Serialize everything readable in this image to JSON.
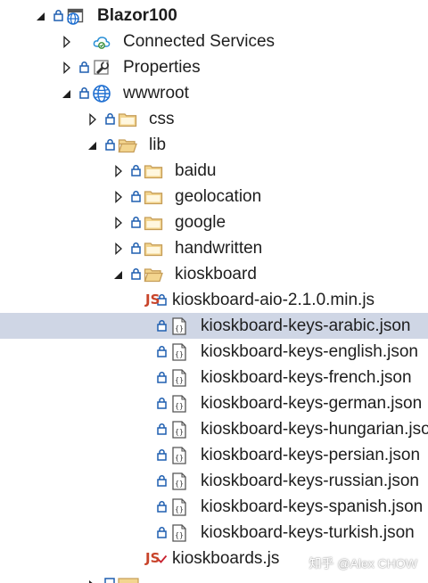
{
  "explorer": {
    "items": [
      {
        "label": "Blazor100",
        "indent": 0,
        "expander": "expanded",
        "marker": "lock",
        "icon": "project",
        "bold": true,
        "selected": false
      },
      {
        "label": "Connected Services",
        "indent": 1,
        "expander": "collapsed",
        "marker": "none",
        "icon": "cloud",
        "bold": false,
        "selected": false
      },
      {
        "label": "Properties",
        "indent": 1,
        "expander": "collapsed",
        "marker": "lock",
        "icon": "wrench",
        "bold": false,
        "selected": false
      },
      {
        "label": "wwwroot",
        "indent": 1,
        "expander": "expanded",
        "marker": "lock",
        "icon": "globe",
        "bold": false,
        "selected": false
      },
      {
        "label": "css",
        "indent": 2,
        "expander": "collapsed",
        "marker": "lock",
        "icon": "folder",
        "bold": false,
        "selected": false
      },
      {
        "label": "lib",
        "indent": 2,
        "expander": "expanded",
        "marker": "lock",
        "icon": "folder-open",
        "bold": false,
        "selected": false
      },
      {
        "label": "baidu",
        "indent": 3,
        "expander": "collapsed",
        "marker": "lock",
        "icon": "folder",
        "bold": false,
        "selected": false
      },
      {
        "label": "geolocation",
        "indent": 3,
        "expander": "collapsed",
        "marker": "lock",
        "icon": "folder",
        "bold": false,
        "selected": false
      },
      {
        "label": "google",
        "indent": 3,
        "expander": "collapsed",
        "marker": "lock",
        "icon": "folder",
        "bold": false,
        "selected": false
      },
      {
        "label": "handwritten",
        "indent": 3,
        "expander": "collapsed",
        "marker": "lock",
        "icon": "folder",
        "bold": false,
        "selected": false
      },
      {
        "label": "kioskboard",
        "indent": 3,
        "expander": "expanded",
        "marker": "lock",
        "icon": "folder-open",
        "bold": false,
        "selected": false
      },
      {
        "label": "kioskboard-aio-2.1.0.min.js",
        "indent": 4,
        "expander": "none",
        "marker": "lock",
        "icon": "js",
        "bold": false,
        "selected": false
      },
      {
        "label": "kioskboard-keys-arabic.json",
        "indent": 4,
        "expander": "none",
        "marker": "lock",
        "icon": "json",
        "bold": false,
        "selected": true
      },
      {
        "label": "kioskboard-keys-english.json",
        "indent": 4,
        "expander": "none",
        "marker": "lock",
        "icon": "json",
        "bold": false,
        "selected": false
      },
      {
        "label": "kioskboard-keys-french.json",
        "indent": 4,
        "expander": "none",
        "marker": "lock",
        "icon": "json",
        "bold": false,
        "selected": false
      },
      {
        "label": "kioskboard-keys-german.json",
        "indent": 4,
        "expander": "none",
        "marker": "lock",
        "icon": "json",
        "bold": false,
        "selected": false
      },
      {
        "label": "kioskboard-keys-hungarian.json",
        "indent": 4,
        "expander": "none",
        "marker": "lock",
        "icon": "json",
        "bold": false,
        "selected": false
      },
      {
        "label": "kioskboard-keys-persian.json",
        "indent": 4,
        "expander": "none",
        "marker": "lock",
        "icon": "json",
        "bold": false,
        "selected": false
      },
      {
        "label": "kioskboard-keys-russian.json",
        "indent": 4,
        "expander": "none",
        "marker": "lock",
        "icon": "json",
        "bold": false,
        "selected": false
      },
      {
        "label": "kioskboard-keys-spanish.json",
        "indent": 4,
        "expander": "none",
        "marker": "lock",
        "icon": "json",
        "bold": false,
        "selected": false
      },
      {
        "label": "kioskboard-keys-turkish.json",
        "indent": 4,
        "expander": "none",
        "marker": "lock",
        "icon": "json",
        "bold": false,
        "selected": false
      },
      {
        "label": "kioskboards.js",
        "indent": 4,
        "expander": "none",
        "marker": "check",
        "icon": "js",
        "bold": false,
        "selected": false
      }
    ],
    "js_icon_text": "JS"
  },
  "watermark": "知乎 @Alex CHOW",
  "colors": {
    "selection": "#cfd6e5",
    "lock": "#1f5fb0",
    "check": "#c8202e",
    "folder": "#c59d58",
    "folder_fill": "#f3d58f",
    "globe": "#1f6fd1",
    "cloud": "#2a8fd6",
    "js": "#c8442a",
    "json": "#555555",
    "arrow": "#1e1e1e"
  }
}
